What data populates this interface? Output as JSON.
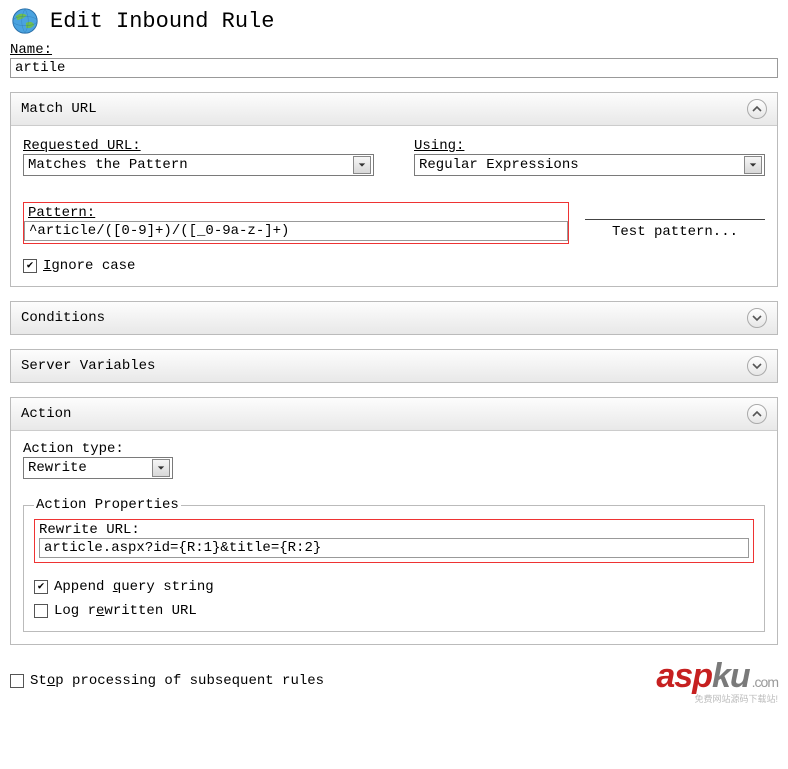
{
  "page": {
    "title": "Edit Inbound Rule",
    "name_label": "Name:",
    "name_value": "artile"
  },
  "match_url": {
    "title": "Match URL",
    "requested_label": "Requested URL:",
    "requested_value": "Matches the Pattern",
    "using_label": "Using:",
    "using_value": "Regular Expressions",
    "pattern_label": "Pattern:",
    "pattern_value": "^article/([0-9]+)/([_0-9a-z-]+)",
    "test_button": "Test pattern...",
    "ignore_case_label": "Ignore case",
    "ignore_case_checked": true
  },
  "conditions": {
    "title": "Conditions"
  },
  "server_vars": {
    "title": "Server Variables"
  },
  "action": {
    "title": "Action",
    "type_label": "Action type:",
    "type_value": "Rewrite",
    "props_legend": "Action Properties",
    "rewrite_label": "Rewrite URL:",
    "rewrite_value": "article.aspx?id={R:1}&title={R:2}",
    "append_label": "Append query string",
    "append_checked": true,
    "log_label": "Log rewritten URL",
    "log_checked": false
  },
  "stop_processing": {
    "label": "Stop processing of subsequent rules",
    "checked": false
  },
  "watermark": {
    "asp": "asp",
    "ku": "ku",
    "dotcom": ".com",
    "sub": "免费网站源码下载站!"
  }
}
